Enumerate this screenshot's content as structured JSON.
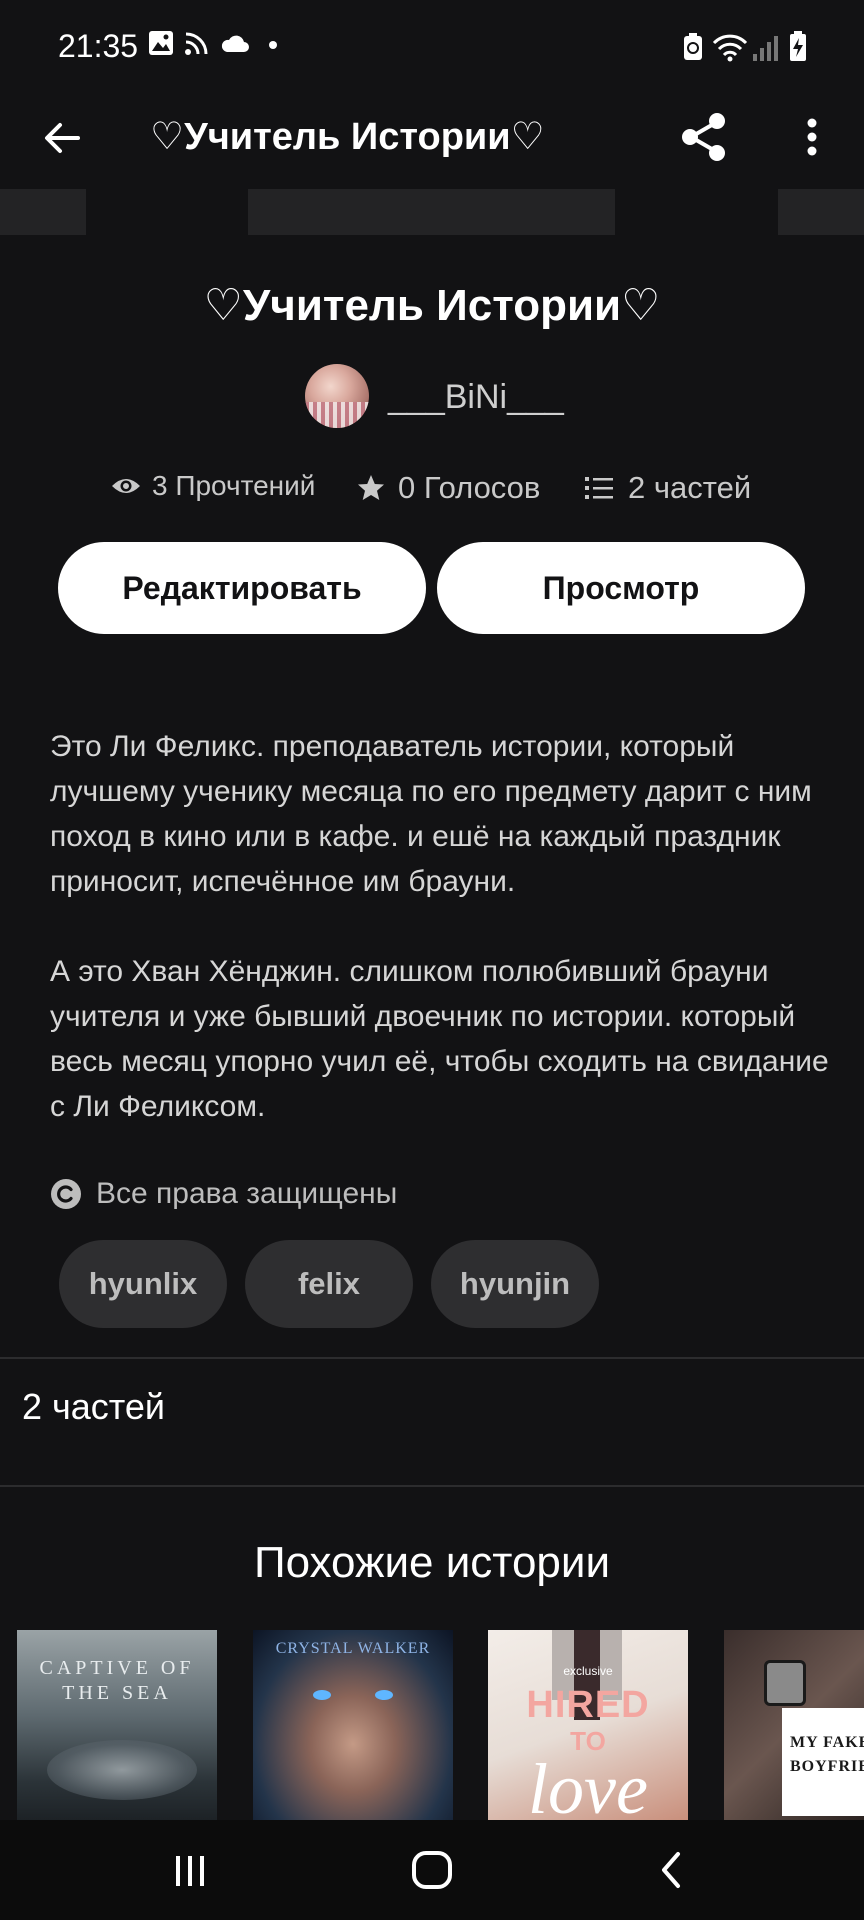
{
  "status_bar": {
    "time": "21:35",
    "left_icons": [
      "image-icon",
      "cast-icon",
      "cloud-icon",
      "dot-icon"
    ],
    "right_icons": [
      "battery-saver-icon",
      "wifi-icon",
      "signal-icon",
      "battery-charging-icon"
    ]
  },
  "app_bar": {
    "title": "♡Учитель Истории♡",
    "icons": [
      "back-arrow-icon",
      "share-icon",
      "more-vert-icon"
    ]
  },
  "story": {
    "title": "♡Учитель Истории♡",
    "author": "___BiNi___",
    "stats": {
      "reads": "3 Прочтений",
      "votes": "0 Голосов",
      "parts": "2 частей"
    },
    "buttons": {
      "edit": "Редактировать",
      "view": "Просмотр"
    },
    "description": [
      "Это Ли Феликс. преподаватель истории, который лучшему ученику месяца по его предмету дарит с ним поход в кино или в кафе. и ешё на каждый праздник приносит, испечённое им брауни.",
      "А это Хван Хёнджин. слишком полюбивший брауни учителя и уже бывший двоечник по истории. который весь месяц упорно учил её, чтобы сходить на свидание с Ли Феликсом."
    ],
    "copyright": "Все права защищены",
    "tags": [
      "hyunlix",
      "felix",
      "hyunjin"
    ],
    "parts_count": "2 частей"
  },
  "similar": {
    "title": "Похожие истории",
    "covers": [
      {
        "text": "CAPTIVE OF THE SEA"
      },
      {
        "text": "CRYSTAL WALKER"
      },
      {
        "badge": "exclusive",
        "text1": "HIRED",
        "text2": "TO",
        "text3": "love"
      },
      {
        "text1": "MY FAKE",
        "text2": "BOYFRIEN"
      }
    ]
  },
  "nav_bar": {
    "icons": [
      "recents-icon",
      "home-icon",
      "back-icon"
    ]
  },
  "colors": {
    "background": "#121214",
    "button_bg": "#ffffff",
    "tag_bg": "#2e2e30",
    "muted_text": "#c9c9c9"
  }
}
